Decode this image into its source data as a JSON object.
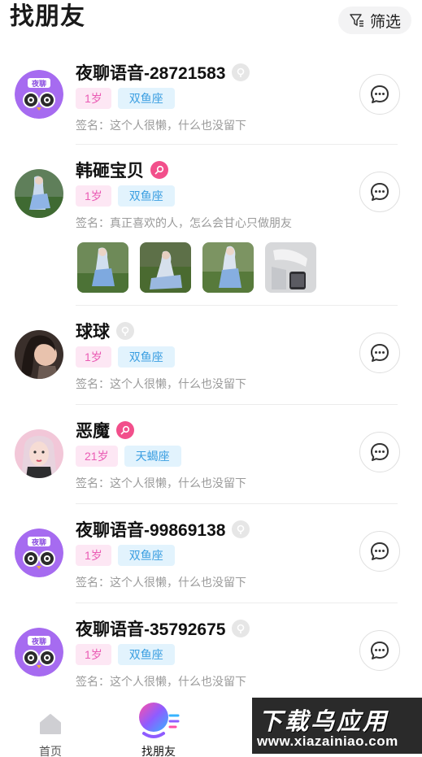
{
  "header": {
    "title": "找朋友",
    "filter_label": "筛选"
  },
  "users": [
    {
      "name": "夜聊语音-28721583",
      "gender": "grey",
      "avatar": "owl-logo",
      "avatar_text": "夜聊",
      "age": "1岁",
      "constellation": "双鱼座",
      "signature": "签名：这个人很懒，什么也没留下"
    },
    {
      "name": "韩砸宝贝",
      "gender": "pink",
      "avatar": "photo",
      "age": "1岁",
      "constellation": "双鱼座",
      "signature": "签名：真正喜欢的人，怎么会甘心只做朋友",
      "photos": [
        "photo-1",
        "photo-2",
        "photo-3",
        "photo-4"
      ]
    },
    {
      "name": "球球",
      "gender": "grey",
      "avatar": "photo",
      "age": "1岁",
      "constellation": "双鱼座",
      "signature": "签名：这个人很懒，什么也没留下"
    },
    {
      "name": "恶魔",
      "gender": "pink",
      "avatar": "photo",
      "age": "21岁",
      "constellation": "天蝎座",
      "signature": "签名：这个人很懒，什么也没留下"
    },
    {
      "name": "夜聊语音-99869138",
      "gender": "grey",
      "avatar": "owl-logo",
      "avatar_text": "夜聊",
      "age": "1岁",
      "constellation": "双鱼座",
      "signature": "签名：这个人很懒，什么也没留下"
    },
    {
      "name": "夜聊语音-35792675",
      "gender": "grey",
      "avatar": "owl-logo",
      "avatar_text": "夜聊",
      "age": "1岁",
      "constellation": "双鱼座",
      "signature": "签名：这个人很懒，什么也没留下"
    }
  ],
  "tabbar": {
    "home_label": "首页",
    "friends_label": "找朋友"
  },
  "watermark": {
    "top": "下载乌应用",
    "bottom": "www.xiazainiao.com"
  },
  "colors": {
    "age_tag_bg": "#fde7f4",
    "age_tag_text": "#ea5bb4",
    "star_tag_bg": "#e2f3fd",
    "star_tag_text": "#3a9ee1",
    "female_badge": "#f24f8b",
    "neutral_badge": "#e6e6e6"
  }
}
